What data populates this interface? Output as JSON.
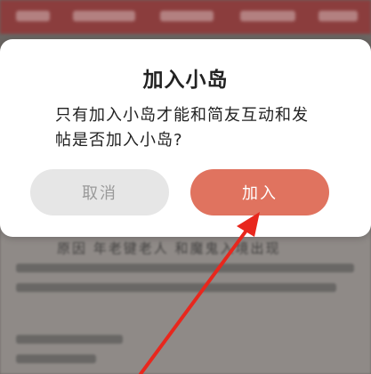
{
  "dialog": {
    "title": "加入小岛",
    "message": "只有加入小岛才能和简友互动和发帖是否加入小岛?",
    "cancel_label": "取消",
    "join_label": "加入"
  },
  "background": {
    "snippet_text": "原因 年老键老人 和魔鬼入境出现"
  },
  "colors": {
    "accent": "#e0735f",
    "annotation_arrow": "#e8271d",
    "cancel_bg": "#e6e6e6"
  },
  "icons": {
    "annotation": "red-arrow-icon"
  }
}
